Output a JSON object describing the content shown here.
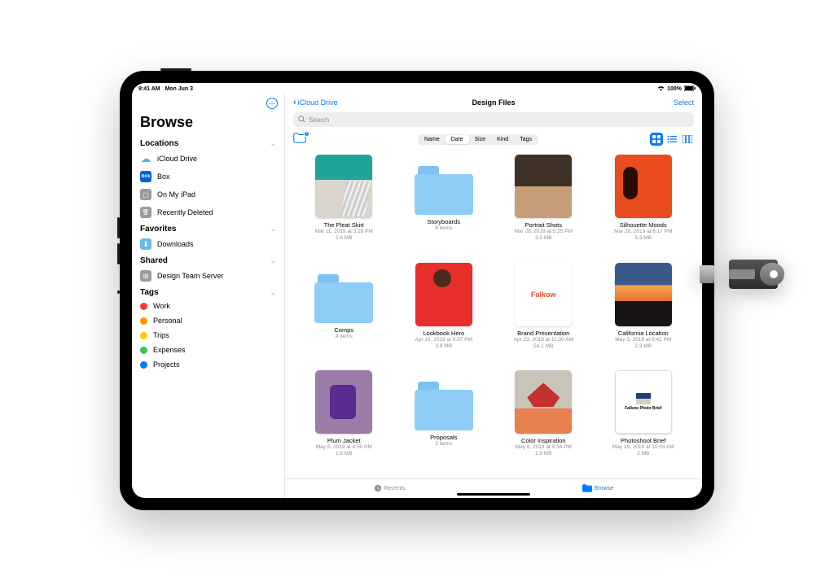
{
  "status": {
    "time": "9:41 AM",
    "date": "Mon Jun 3",
    "battery": "100%"
  },
  "sidebar": {
    "title": "Browse",
    "sections": {
      "locations": {
        "header": "Locations",
        "items": [
          {
            "label": "iCloud Drive"
          },
          {
            "label": "Box"
          },
          {
            "label": "On My iPad"
          },
          {
            "label": "Recently Deleted"
          }
        ]
      },
      "favorites": {
        "header": "Favorites",
        "items": [
          {
            "label": "Downloads"
          }
        ]
      },
      "shared": {
        "header": "Shared",
        "items": [
          {
            "label": "Design Team Server"
          }
        ]
      },
      "tags": {
        "header": "Tags",
        "items": [
          {
            "label": "Work",
            "color": "#ff3b30"
          },
          {
            "label": "Personal",
            "color": "#ff9500"
          },
          {
            "label": "Trips",
            "color": "#ffcc00"
          },
          {
            "label": "Expenses",
            "color": "#34c759"
          },
          {
            "label": "Projects",
            "color": "#007aff"
          }
        ]
      }
    }
  },
  "nav": {
    "back": "iCloud Drive",
    "title": "Design Files",
    "select": "Select"
  },
  "search": {
    "placeholder": "Search"
  },
  "sort": {
    "options": [
      "Name",
      "Date",
      "Size",
      "Kind",
      "Tags"
    ],
    "active": "Date"
  },
  "files": [
    {
      "name": "The Pleat Skirt",
      "meta1": "Mar 11, 2019 at 3:28 PM",
      "meta2": "2.6 MB",
      "type": "image",
      "thumb": "th-pleat"
    },
    {
      "name": "Storyboards",
      "meta1": "8 items",
      "meta2": "",
      "type": "folder"
    },
    {
      "name": "Portrait Shots",
      "meta1": "Mar 28, 2019 at 5:25 PM",
      "meta2": "3.5 MB",
      "type": "image",
      "thumb": "th-portrait"
    },
    {
      "name": "Silhouette Moods",
      "meta1": "Mar 28, 2019 at 6:17 PM",
      "meta2": "5.3 MB",
      "type": "image",
      "thumb": "th-silhouette"
    },
    {
      "name": "Comps",
      "meta1": "4 items",
      "meta2": "",
      "type": "folder"
    },
    {
      "name": "Lookbook Hero",
      "meta1": "Apr 19, 2019 at 9:37 PM",
      "meta2": "3.8 MB",
      "type": "image",
      "thumb": "th-lookbook"
    },
    {
      "name": "Brand Presentation",
      "meta1": "Apr 23, 2019 at 11:30 AM",
      "meta2": "54.1 MB",
      "type": "doc",
      "thumb": "th-brand",
      "brand": "Falkow"
    },
    {
      "name": "California Location",
      "meta1": "May 3, 2019 at 8:42 PM",
      "meta2": "2.3 MB",
      "type": "image",
      "thumb": "th-california"
    },
    {
      "name": "Plum Jacket",
      "meta1": "May 6, 2019 at 4:50 PM",
      "meta2": "1.6 MB",
      "type": "image",
      "thumb": "th-plum"
    },
    {
      "name": "Proposals",
      "meta1": "3 items",
      "meta2": "",
      "type": "folder"
    },
    {
      "name": "Color Inspiration",
      "meta1": "May 8, 2019 at 5:34 PM",
      "meta2": "1.9 MB",
      "type": "image",
      "thumb": "th-color"
    },
    {
      "name": "Photoshoot Brief",
      "meta1": "May 26, 2019 at 10:03 AM",
      "meta2": "2 MB",
      "type": "doc",
      "thumb": "th-photoshoot",
      "brief": "Falkow\nPhoto Brief"
    }
  ],
  "bottom": {
    "recents": "Recents",
    "browse": "Browse"
  }
}
